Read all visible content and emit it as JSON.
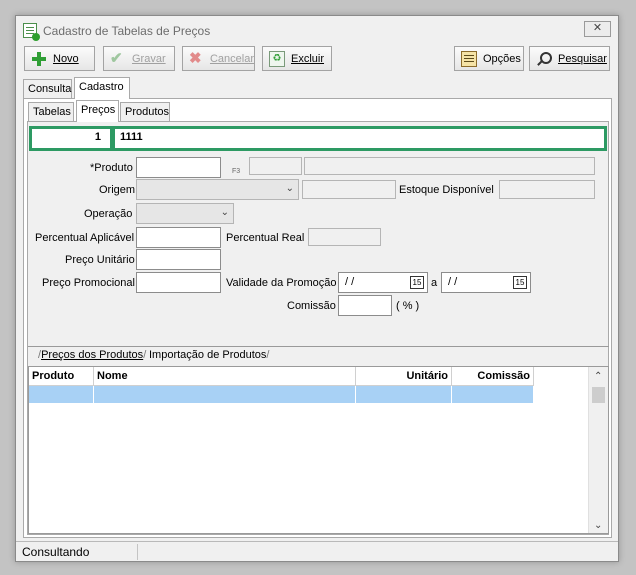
{
  "window": {
    "title": "Cadastro de Tabelas de Preços",
    "close_glyph": "✕"
  },
  "toolbar": {
    "novo": "Novo",
    "gravar": "Gravar",
    "cancelar": "Cancelar",
    "excluir": "Excluir",
    "opcoes": "Opções",
    "pesquisar": "Pesquisar"
  },
  "main_tabs": [
    "Consulta",
    "Cadastro"
  ],
  "sub_tabs": [
    "Tabelas",
    "Preços",
    "Produtos"
  ],
  "header": {
    "code": "1",
    "name": "1111"
  },
  "form": {
    "produto_label": "*Produto",
    "f3_hint": "F3",
    "origem_label": "Origem",
    "estoque_label": "Estoque Disponível",
    "operacao_label": "Operação",
    "percentual_aplicavel_label": "Percentual Aplicável",
    "percentual_real_label": "Percentual Real",
    "preco_unitario_label": "Preço Unitário",
    "preco_promocional_label": "Preço Promocional",
    "validade_label": "Validade da Promoção",
    "date_from": "/ /",
    "date_to": "/ /",
    "date_sep": "a",
    "comissao_label": "Comissão",
    "comissao_unit": "( % )"
  },
  "bottom_tabs": [
    "Preços dos Produtos",
    "Importação de Produtos"
  ],
  "grid": {
    "columns": [
      "Produto",
      "Nome",
      "Unitário",
      "Comissão"
    ],
    "selected_row_color": "#a8d1f5"
  },
  "status": {
    "text": "Consultando"
  },
  "colors": {
    "accent": "#2d9a63"
  }
}
